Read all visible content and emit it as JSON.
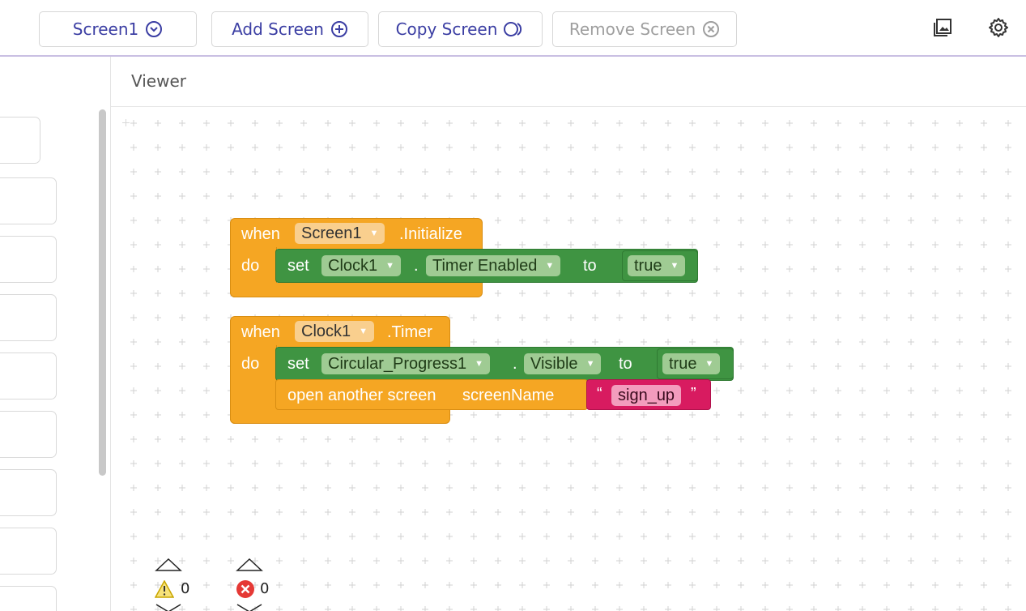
{
  "toolbar": {
    "screen_select": "Screen1",
    "add_screen": "Add Screen",
    "copy_screen": "Copy Screen",
    "remove_screen": "Remove Screen",
    "icons": [
      "chevron-circle-down-icon",
      "add-circle-icon",
      "copy-circle-icon",
      "remove-circle-icon",
      "gallery-icon",
      "gear-icon"
    ]
  },
  "viewer": {
    "title": "Viewer"
  },
  "blocks": {
    "init_event": {
      "when": "when",
      "component": "Screen1",
      "event": ".Initialize",
      "do": "do",
      "set": {
        "set": "set",
        "component": "Clock1",
        "dot": ".",
        "property": "Timer Enabled",
        "to": "to",
        "value": "true"
      }
    },
    "timer_event": {
      "when": "when",
      "component": "Clock1",
      "event": ".Timer",
      "do": "do",
      "set": {
        "set": "set",
        "component": "Circular_Progress1",
        "dot": ".",
        "property": "Visible",
        "to": "to",
        "value": "true"
      },
      "open": {
        "label": "open another screen",
        "param": "screenName",
        "open_quote": "“",
        "text": "sign_up",
        "close_quote": "”"
      }
    }
  },
  "indicators": {
    "warnings": "0",
    "errors": "0"
  },
  "colors": {
    "event_orange": "#f5a623",
    "set_green": "#3f9442",
    "text_pink": "#d81b60",
    "accent_purple": "#3b3ea3"
  }
}
